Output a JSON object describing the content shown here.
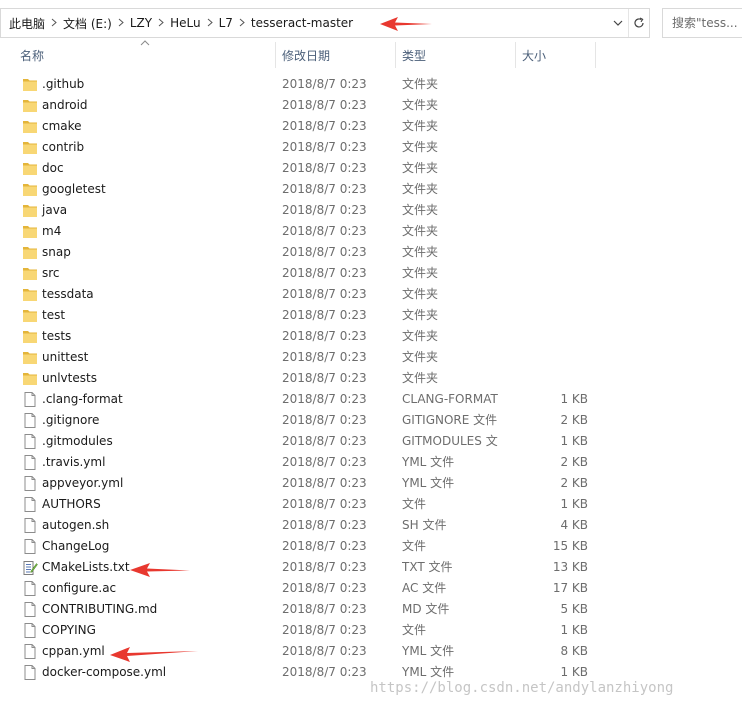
{
  "breadcrumbs": [
    "此电脑",
    "文档 (E:)",
    "LZY",
    "HeLu",
    "L7",
    "tesseract-master"
  ],
  "search": {
    "placeholder": "搜索\"tess..."
  },
  "columns": {
    "name": "名称",
    "date": "修改日期",
    "type": "类型",
    "size": "大小"
  },
  "files": [
    {
      "name": ".github",
      "date": "2018/8/7 0:23",
      "type": "文件夹",
      "size": "",
      "kind": "folder"
    },
    {
      "name": "android",
      "date": "2018/8/7 0:23",
      "type": "文件夹",
      "size": "",
      "kind": "folder"
    },
    {
      "name": "cmake",
      "date": "2018/8/7 0:23",
      "type": "文件夹",
      "size": "",
      "kind": "folder"
    },
    {
      "name": "contrib",
      "date": "2018/8/7 0:23",
      "type": "文件夹",
      "size": "",
      "kind": "folder"
    },
    {
      "name": "doc",
      "date": "2018/8/7 0:23",
      "type": "文件夹",
      "size": "",
      "kind": "folder"
    },
    {
      "name": "googletest",
      "date": "2018/8/7 0:23",
      "type": "文件夹",
      "size": "",
      "kind": "folder"
    },
    {
      "name": "java",
      "date": "2018/8/7 0:23",
      "type": "文件夹",
      "size": "",
      "kind": "folder"
    },
    {
      "name": "m4",
      "date": "2018/8/7 0:23",
      "type": "文件夹",
      "size": "",
      "kind": "folder"
    },
    {
      "name": "snap",
      "date": "2018/8/7 0:23",
      "type": "文件夹",
      "size": "",
      "kind": "folder"
    },
    {
      "name": "src",
      "date": "2018/8/7 0:23",
      "type": "文件夹",
      "size": "",
      "kind": "folder"
    },
    {
      "name": "tessdata",
      "date": "2018/8/7 0:23",
      "type": "文件夹",
      "size": "",
      "kind": "folder"
    },
    {
      "name": "test",
      "date": "2018/8/7 0:23",
      "type": "文件夹",
      "size": "",
      "kind": "folder"
    },
    {
      "name": "tests",
      "date": "2018/8/7 0:23",
      "type": "文件夹",
      "size": "",
      "kind": "folder"
    },
    {
      "name": "unittest",
      "date": "2018/8/7 0:23",
      "type": "文件夹",
      "size": "",
      "kind": "folder"
    },
    {
      "name": "unlvtests",
      "date": "2018/8/7 0:23",
      "type": "文件夹",
      "size": "",
      "kind": "folder"
    },
    {
      "name": ".clang-format",
      "date": "2018/8/7 0:23",
      "type": "CLANG-FORMAT",
      "size": "1 KB",
      "kind": "file"
    },
    {
      "name": ".gitignore",
      "date": "2018/8/7 0:23",
      "type": "GITIGNORE 文件",
      "size": "2 KB",
      "kind": "file"
    },
    {
      "name": ".gitmodules",
      "date": "2018/8/7 0:23",
      "type": "GITMODULES 文",
      "size": "1 KB",
      "kind": "file"
    },
    {
      "name": ".travis.yml",
      "date": "2018/8/7 0:23",
      "type": "YML 文件",
      "size": "2 KB",
      "kind": "file"
    },
    {
      "name": "appveyor.yml",
      "date": "2018/8/7 0:23",
      "type": "YML 文件",
      "size": "2 KB",
      "kind": "file"
    },
    {
      "name": "AUTHORS",
      "date": "2018/8/7 0:23",
      "type": "文件",
      "size": "1 KB",
      "kind": "file"
    },
    {
      "name": "autogen.sh",
      "date": "2018/8/7 0:23",
      "type": "SH 文件",
      "size": "4 KB",
      "kind": "file"
    },
    {
      "name": "ChangeLog",
      "date": "2018/8/7 0:23",
      "type": "文件",
      "size": "15 KB",
      "kind": "file"
    },
    {
      "name": "CMakeLists.txt",
      "date": "2018/8/7 0:23",
      "type": "TXT 文件",
      "size": "13 KB",
      "kind": "text"
    },
    {
      "name": "configure.ac",
      "date": "2018/8/7 0:23",
      "type": "AC 文件",
      "size": "17 KB",
      "kind": "file"
    },
    {
      "name": "CONTRIBUTING.md",
      "date": "2018/8/7 0:23",
      "type": "MD 文件",
      "size": "5 KB",
      "kind": "file"
    },
    {
      "name": "COPYING",
      "date": "2018/8/7 0:23",
      "type": "文件",
      "size": "1 KB",
      "kind": "file"
    },
    {
      "name": "cppan.yml",
      "date": "2018/8/7 0:23",
      "type": "YML 文件",
      "size": "8 KB",
      "kind": "file"
    },
    {
      "name": "docker-compose.yml",
      "date": "2018/8/7 0:23",
      "type": "YML 文件",
      "size": "1 KB",
      "kind": "file"
    }
  ],
  "watermark": "https://blog.csdn.net/andylanzhiyong",
  "colors": {
    "folder": "#f8d775",
    "folder_dark": "#e4b53a",
    "annotation_arrow": "#e8382f",
    "header_text": "#4c607a"
  },
  "icons": {
    "folder": "folder-icon",
    "file": "file-icon",
    "text": "text-file-icon",
    "dropdown": "chevron-down-icon",
    "refresh": "refresh-icon",
    "separator": "chevron-right-icon"
  }
}
